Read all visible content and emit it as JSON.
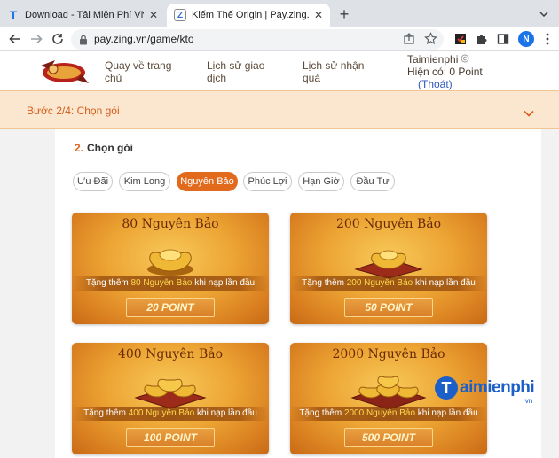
{
  "browser": {
    "tabs": [
      {
        "title": "Download - Tải Miễn Phí VN - Phần",
        "icon": "T",
        "active": false
      },
      {
        "title": "Kiếm Thế Origin | Pay.zing.vn - Cổn",
        "icon": "Z",
        "active": true
      }
    ],
    "url": "pay.zing.vn/game/kto",
    "profile_initial": "N"
  },
  "site": {
    "nav": [
      {
        "line1": "Quay về trang",
        "line2": "chủ"
      },
      {
        "line1": "Lịch sử giao",
        "line2": "dịch"
      },
      {
        "line1": "Lịch sử nhận",
        "line2": "quà"
      }
    ],
    "account": {
      "username": "Taimienphi",
      "balance": "Hiện có: 0 Point",
      "logout": "(Thoát)"
    },
    "step_label": "Bước 2/4: Chọn gói"
  },
  "section": {
    "number": "2.",
    "title": "Chọn gói"
  },
  "filters": [
    {
      "label": "Ưu Đãi",
      "active": false
    },
    {
      "label": "Kim Long",
      "active": false
    },
    {
      "label": "Nguyên Bảo",
      "active": true
    },
    {
      "label": "Phúc Lợi",
      "active": false
    },
    {
      "label": "Hạn Giờ",
      "active": false
    },
    {
      "label": "Đầu Tư",
      "active": false
    }
  ],
  "packages": [
    {
      "title": "80 Nguyên Bảo",
      "bonus_pre": "Tặng thêm ",
      "bonus_hl": "80 Nguyên Bảo",
      "bonus_post": " khi nạp lần đầu",
      "price": "20 POINT"
    },
    {
      "title": "200 Nguyên Bảo",
      "bonus_pre": "Tặng thêm ",
      "bonus_hl": "200 Nguyên Bảo",
      "bonus_post": " khi nạp lần đầu",
      "price": "50 POINT"
    },
    {
      "title": "400 Nguyên Bảo",
      "bonus_pre": "Tặng thêm ",
      "bonus_hl": "400 Nguyên Bảo",
      "bonus_post": " khi nạp lần đầu",
      "price": "100 POINT"
    },
    {
      "title": "2000 Nguyên Bảo",
      "bonus_pre": "Tặng thêm ",
      "bonus_hl": "2000 Nguyên Bảo",
      "bonus_post": " khi nạp lần đầu",
      "price": "500 POINT"
    }
  ],
  "watermark": {
    "mark": "T",
    "name": "aimienphi",
    "suffix": ".vn"
  },
  "colors": {
    "accent": "#e26a1c",
    "step_bg": "#fbe6cf",
    "link": "#2e56b8"
  }
}
